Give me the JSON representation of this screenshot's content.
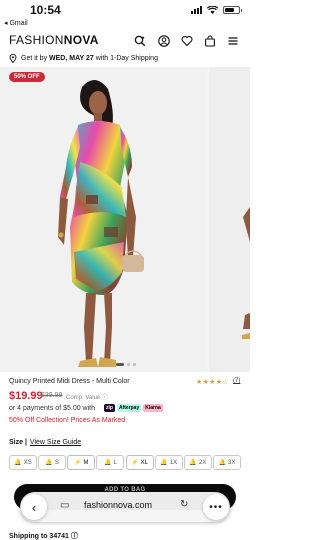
{
  "status_bar": {
    "time": "10:54",
    "back_app": "◂ Gmail"
  },
  "header": {
    "logo_part1": "FASHION",
    "logo_part2": "NOVA"
  },
  "shipping_banner": {
    "text_prefix": "Get it by ",
    "date": "WED, MAY 27",
    "text_suffix": " with 1-Day Shipping"
  },
  "gallery": {
    "badge": "50% OFF",
    "dot_count": 3
  },
  "product": {
    "name": "Quincy Printed Midi Dress - Multi Color",
    "stars": "★★★★☆",
    "review_count": "(7)",
    "price": "$19.99",
    "original_price": "$39.99",
    "comp_value": "Comp. Value",
    "installments": "or 4 payments of $5.00 with",
    "pay_options": [
      "zip",
      "Afterpay",
      "Klarna"
    ],
    "promo": "50% Off Collection! Prices As Marked"
  },
  "size_section": {
    "label": "Size |",
    "guide": "View Size Guide",
    "options": [
      {
        "label": "XS",
        "icon": "bell-icon",
        "in_stock": false
      },
      {
        "label": "S",
        "icon": "bell-icon",
        "in_stock": false
      },
      {
        "label": "M",
        "icon": "bolt-icon",
        "in_stock": true
      },
      {
        "label": "L",
        "icon": "bell-icon",
        "in_stock": false
      },
      {
        "label": "XL",
        "icon": "bolt-icon",
        "in_stock": true
      },
      {
        "label": "1X",
        "icon": "bell-icon",
        "in_stock": false
      },
      {
        "label": "2X",
        "icon": "bell-icon",
        "in_stock": false
      },
      {
        "label": "3X",
        "icon": "bell-icon",
        "in_stock": false
      }
    ]
  },
  "cta": {
    "label": "ADD TO BAG"
  },
  "safari": {
    "url": "fashionnova.com"
  },
  "footer": {
    "shipping_to": "Shipping to 34741 ⓘ"
  },
  "colors": {
    "sale_red": "#d02330",
    "badge_red": "#cc2b36",
    "star_gold": "#d8a03a",
    "cta_black": "#0b0b0b"
  }
}
